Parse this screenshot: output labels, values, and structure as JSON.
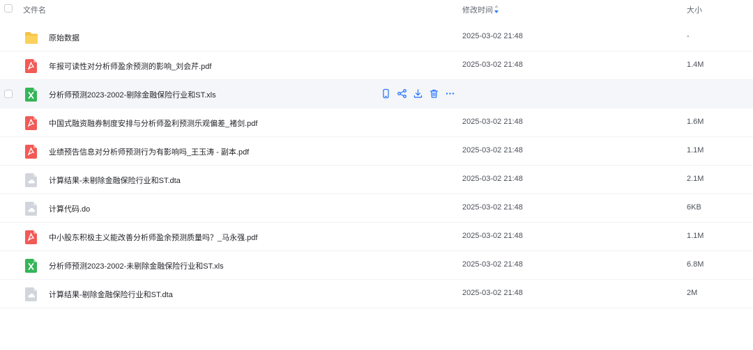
{
  "header": {
    "name_label": "文件名",
    "time_label": "修改时间",
    "size_label": "大小",
    "sort_icon": "sort-desc-icon"
  },
  "colors": {
    "folder": "#f7c244",
    "pdf": "#f15a56",
    "xls": "#35b558",
    "generic": "#d2d5db",
    "action": "#2b78ff"
  },
  "files": [
    {
      "name": "原始数据",
      "type": "folder",
      "modified": "2025-03-02 21:48",
      "size": "-"
    },
    {
      "name": "年报可读性对分析师盈余预测的影响_刘会芹.pdf",
      "type": "pdf",
      "modified": "2025-03-02 21:48",
      "size": "1.4M"
    },
    {
      "name": "分析师预测2023-2002-剔除金融保险行业和ST.xls",
      "type": "xls",
      "modified": "",
      "size": "",
      "hovered": true,
      "actions": [
        "phone-icon",
        "share-icon",
        "download-icon",
        "delete-icon",
        "more-icon"
      ]
    },
    {
      "name": "中国式融资融券制度安排与分析师盈利预测乐观偏差_褚剑.pdf",
      "type": "pdf",
      "modified": "2025-03-02 21:48",
      "size": "1.6M"
    },
    {
      "name": "业绩预告信息对分析师预测行为有影响吗_王玉涛 - 副本.pdf",
      "type": "pdf",
      "modified": "2025-03-02 21:48",
      "size": "1.1M"
    },
    {
      "name": "计算结果-未剔除金融保险行业和ST.dta",
      "type": "generic",
      "modified": "2025-03-02 21:48",
      "size": "2.1M"
    },
    {
      "name": "计算代码.do",
      "type": "generic",
      "modified": "2025-03-02 21:48",
      "size": "6KB"
    },
    {
      "name": "中小股东积极主义能改善分析师盈余预测质量吗？_马永强.pdf",
      "type": "pdf",
      "modified": "2025-03-02 21:48",
      "size": "1.1M"
    },
    {
      "name": "分析师预测2023-2002-未剔除金融保险行业和ST.xls",
      "type": "xls",
      "modified": "2025-03-02 21:48",
      "size": "6.8M"
    },
    {
      "name": "计算结果-剔除金融保险行业和ST.dta",
      "type": "generic",
      "modified": "2025-03-02 21:48",
      "size": "2M"
    }
  ]
}
